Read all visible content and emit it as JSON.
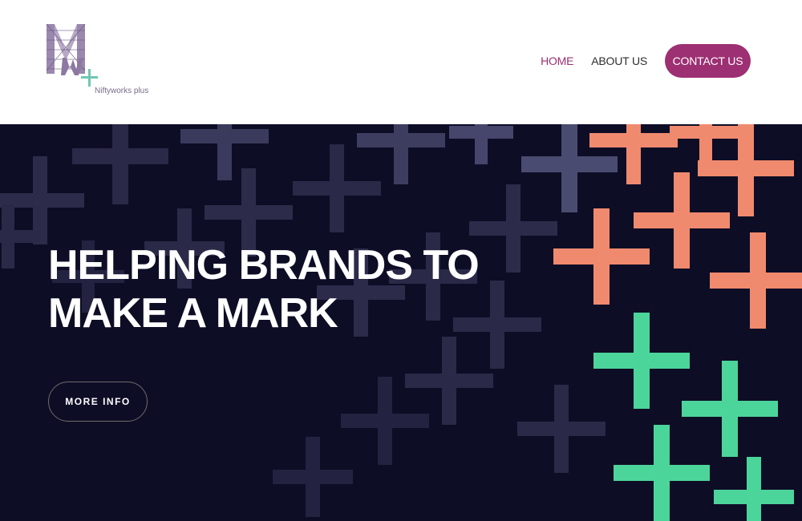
{
  "brand": {
    "logo_text": "Niftyworks plus",
    "colors": {
      "primary": "#9d2f73",
      "hero_bg": "#0e0d26",
      "salmon": "#f08a6e",
      "green": "#4cd59a",
      "slate": "#3a3a5c"
    }
  },
  "nav": {
    "items": [
      {
        "label": "HOME",
        "active": true
      },
      {
        "label": "ABOUT US",
        "active": false
      }
    ],
    "contact_label": "CONTACT US"
  },
  "hero": {
    "title_line1": "HELPING BRANDS TO",
    "title_line2": "MAKE A MARK",
    "cta_label": "MORE INFO"
  }
}
